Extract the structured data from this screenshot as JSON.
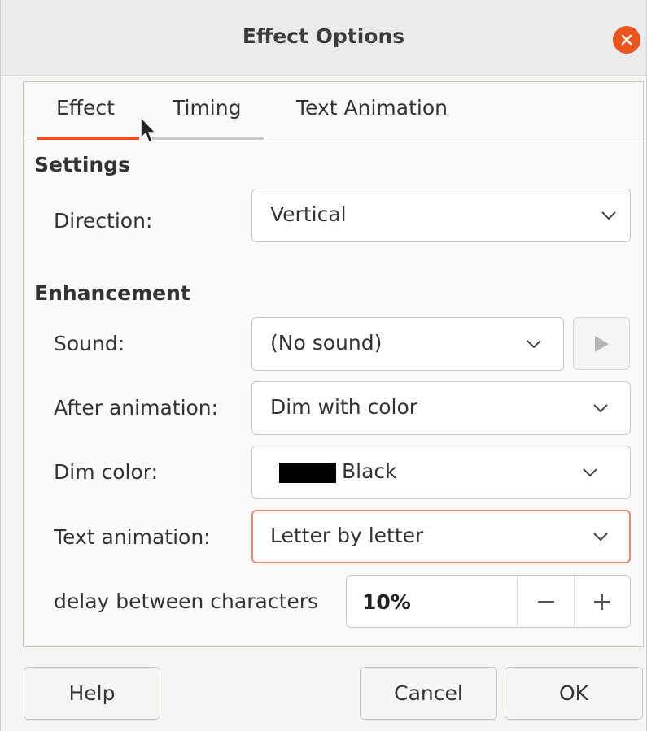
{
  "window": {
    "title": "Effect Options"
  },
  "tabs": [
    {
      "label": "Effect",
      "selected": true
    },
    {
      "label": "Timing",
      "selected": false
    },
    {
      "label": "Text Animation",
      "selected": false
    }
  ],
  "settings": {
    "heading": "Settings",
    "direction": {
      "label": "Direction:",
      "value": "Vertical"
    }
  },
  "enhancement": {
    "heading": "Enhancement",
    "sound": {
      "label": "Sound:",
      "value": "(No sound)"
    },
    "after_animation": {
      "label": "After animation:",
      "value": "Dim with color"
    },
    "dim_color": {
      "label": "Dim color:",
      "value": "Black",
      "swatch": "#000000"
    },
    "text_animation": {
      "label": "Text animation:",
      "value": "Letter by letter"
    },
    "delay": {
      "label": "delay between characters",
      "value": "10%"
    }
  },
  "buttons": {
    "help": "Help",
    "cancel": "Cancel",
    "ok": "OK"
  },
  "colors": {
    "accent": "#e95420",
    "focus_border": "#e38b70"
  },
  "icons": [
    "close-icon",
    "chevron-down-icon",
    "play-icon",
    "minus-icon",
    "plus-icon",
    "mouse-pointer-icon"
  ]
}
